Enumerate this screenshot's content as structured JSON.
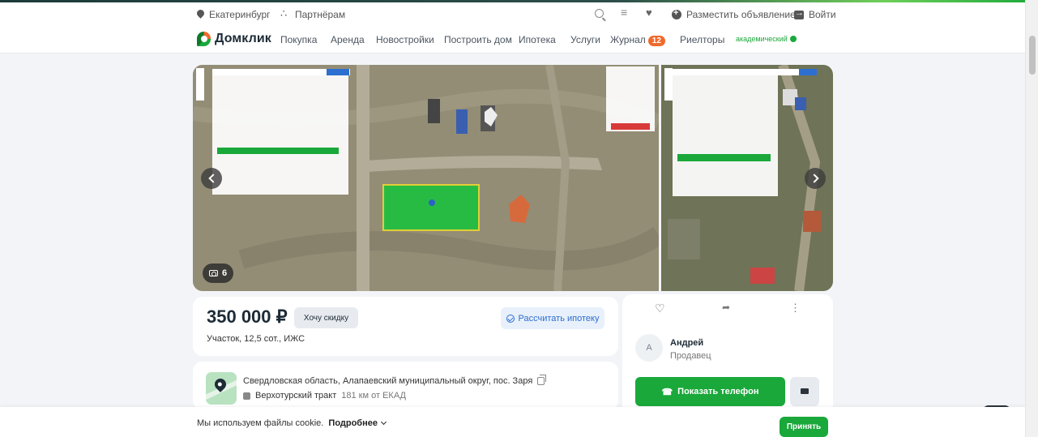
{
  "topbar": {
    "city": "Екатеринбург",
    "partners": "Партнёрам",
    "post_ad": "Разместить объявление",
    "login": "Войти"
  },
  "nav": {
    "logo": "Домклик",
    "links": [
      "Покупка",
      "Аренда",
      "Новостройки",
      "Построить дом",
      "Ипотека",
      "Услуги"
    ],
    "journal": "Журнал",
    "journal_count": "12",
    "realtors": "Риелторы",
    "promo": "академический"
  },
  "gallery": {
    "photo_count": "6",
    "icons": [
      "camera-icon",
      "chevron-left-icon",
      "chevron-right-icon"
    ]
  },
  "listing": {
    "price": "350 000 ₽",
    "discount_label": "Хочу скидку",
    "mortgage_label": "Рассчитать ипотеку",
    "subtitle": "Участок, 12,5 сот., ИЖС",
    "address": "Свердловская область, Алапаевский муниципальный округ, пос. Заря",
    "route": "Верхотурский тракт",
    "route_distance": "181 км от ЕКАД"
  },
  "seller": {
    "avatar_letter": "А",
    "name": "Андрей",
    "role": "Продавец",
    "phone_label": "Показать телефон"
  },
  "cookie": {
    "text": "Мы используем файлы cookie.",
    "more": "Подробнее",
    "accept": "Принять"
  },
  "colors": {
    "brand_green": "#1aa83a",
    "accent_orange": "#f06a2c",
    "link_blue": "#2c6fd1"
  }
}
